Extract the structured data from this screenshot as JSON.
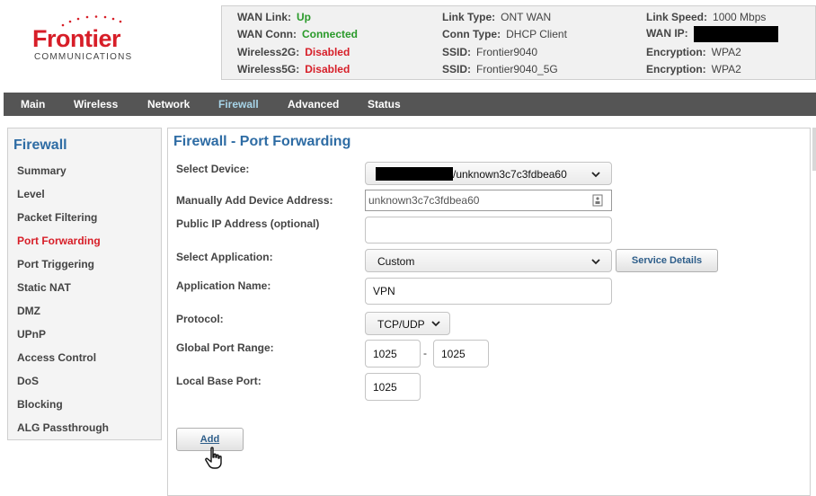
{
  "brand": {
    "name": "Frontier",
    "tagline": "COMMUNICATIONS",
    "color": "#d71e28"
  },
  "status": {
    "wan_link": {
      "label": "WAN Link:",
      "value": "Up"
    },
    "wan_conn": {
      "label": "WAN Conn:",
      "value": "Connected"
    },
    "wireless2g": {
      "label": "Wireless2G:",
      "value": "Disabled"
    },
    "wireless5g": {
      "label": "Wireless5G:",
      "value": "Disabled"
    },
    "link_type": {
      "label": "Link Type:",
      "value": "ONT WAN"
    },
    "conn_type": {
      "label": "Conn Type:",
      "value": "DHCP Client"
    },
    "ssid1": {
      "label": "SSID:",
      "value": "Frontier9040"
    },
    "ssid2": {
      "label": "SSID:",
      "value": "Frontier9040_5G"
    },
    "link_speed": {
      "label": "Link Speed:",
      "value": "1000 Mbps"
    },
    "wan_ip": {
      "label": "WAN IP:"
    },
    "encryption1": {
      "label": "Encryption:",
      "value": "WPA2"
    },
    "encryption2": {
      "label": "Encryption:",
      "value": "WPA2"
    }
  },
  "nav": [
    "Main",
    "Wireless",
    "Network",
    "Firewall",
    "Advanced",
    "Status"
  ],
  "sidebar": {
    "title": "Firewall",
    "items": [
      "Summary",
      "Level",
      "Packet Filtering",
      "Port Forwarding",
      "Port Triggering",
      "Static NAT",
      "DMZ",
      "UPnP",
      "Access Control",
      "DoS",
      "Blocking",
      "ALG Passthrough"
    ]
  },
  "main": {
    "title": "Firewall - Port Forwarding",
    "labels": {
      "device": "Select Device:",
      "manual": "Manually Add Device Address:",
      "public_ip": "Public IP Address (optional)",
      "application": "Select Application:",
      "app_name": "Application Name:",
      "protocol": "Protocol:",
      "port_range": "Global Port Range:",
      "local_port": "Local Base Port:"
    },
    "device_value": "/unknown3c7c3fdbea60",
    "manual_value": "unknown3c7c3fdbea60",
    "public_ip_value": "",
    "application_value": "Custom",
    "service_details_button": "Service Details",
    "app_name_value": "VPN",
    "protocol_value": "TCP/UDP",
    "port_start": "1025",
    "port_separator": "-",
    "port_end": "1025",
    "local_port_value": "1025",
    "add_button": "Add"
  },
  "icons": [
    "chevron-down-icon",
    "contact-card-icon",
    "hand-pointer-icon"
  ]
}
